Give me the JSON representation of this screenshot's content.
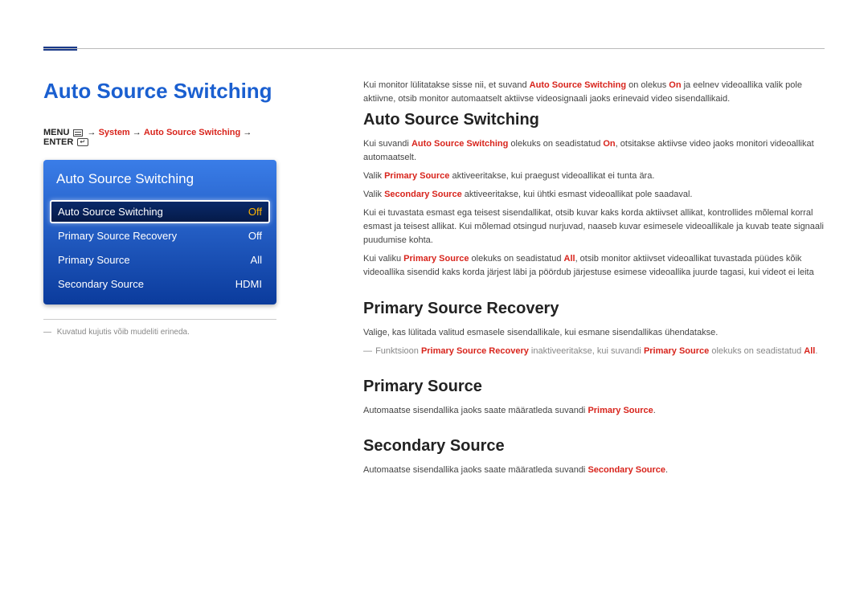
{
  "left": {
    "title": "Auto Source Switching",
    "breadcrumb": {
      "menu": "MENU",
      "arrow": "→",
      "system": "System",
      "feature": "Auto Source Switching",
      "enter": "ENTER"
    },
    "panel": {
      "header": "Auto Source Switching",
      "rows": [
        {
          "label": "Auto Source Switching",
          "value": "Off",
          "selected": true
        },
        {
          "label": "Primary Source Recovery",
          "value": "Off",
          "selected": false
        },
        {
          "label": "Primary Source",
          "value": "All",
          "selected": false
        },
        {
          "label": "Secondary Source",
          "value": "HDMI",
          "selected": false
        }
      ]
    },
    "footnote": "Kuvatud kujutis võib mudeliti erineda."
  },
  "right": {
    "intro_pre": "Kui monitor lülitatakse sisse nii, et suvand ",
    "intro_b1": "Auto Source Switching",
    "intro_mid1": " on olekus ",
    "intro_b2": "On",
    "intro_post": " ja eelnev videoallika valik pole aktiivne, otsib monitor automaatselt aktiivse videosignaali jaoks erinevaid video sisendallikaid.",
    "h_ass": "Auto Source Switching",
    "p_ass_1_a": "Kui suvandi ",
    "p_ass_1_b1": "Auto Source Switching",
    "p_ass_1_b": " olekuks on seadistatud ",
    "p_ass_1_b2": "On",
    "p_ass_1_c": ", otsitakse aktiivse video jaoks monitori videoallikat automaatselt.",
    "p_ass_2_a": "Valik ",
    "p_ass_2_b1": "Primary Source",
    "p_ass_2_c": " aktiveeritakse, kui praegust videoallikat ei tunta ära.",
    "p_ass_3_a": "Valik ",
    "p_ass_3_b1": "Secondary Source",
    "p_ass_3_c": " aktiveeritakse, kui ühtki esmast videoallikat pole saadaval.",
    "p_ass_4": "Kui ei tuvastata esmast ega teisest sisendallikat, otsib kuvar kaks korda aktiivset allikat, kontrollides mõlemal korral esmast ja teisest allikat. Kui mõlemad otsingud nurjuvad, naaseb kuvar esimesele videoallikale ja kuvab teate signaali puudumise kohta.",
    "p_ass_5_a": "Kui valiku ",
    "p_ass_5_b1": "Primary Source",
    "p_ass_5_b": " olekuks on seadistatud ",
    "p_ass_5_b2": "All",
    "p_ass_5_c": ", otsib monitor aktiivset videoallikat tuvastada püüdes kõik videoallika sisendid kaks korda järjest läbi ja pöördub järjestuse esimese videoallika juurde tagasi, kui videot ei leita",
    "h_psr": "Primary Source Recovery",
    "p_psr_1": "Valige, kas lülitada valitud esmasele sisendallikale, kui esmane sisendallikas ühendatakse.",
    "p_psr_note_a": "Funktsioon ",
    "p_psr_note_b1": "Primary Source Recovery",
    "p_psr_note_b": " inaktiveeritakse, kui suvandi ",
    "p_psr_note_b2": "Primary Source",
    "p_psr_note_c": " olekuks on seadistatud ",
    "p_psr_note_b3": "All",
    "p_psr_note_d": ".",
    "h_ps": "Primary Source",
    "p_ps_a": "Automaatse sisendallika jaoks saate määratleda suvandi ",
    "p_ps_b1": "Primary Source",
    "p_ps_c": ".",
    "h_ss": "Secondary Source",
    "p_ss_a": "Automaatse sisendallika jaoks saate määratleda suvandi ",
    "p_ss_b1": "Secondary Source",
    "p_ss_c": "."
  }
}
